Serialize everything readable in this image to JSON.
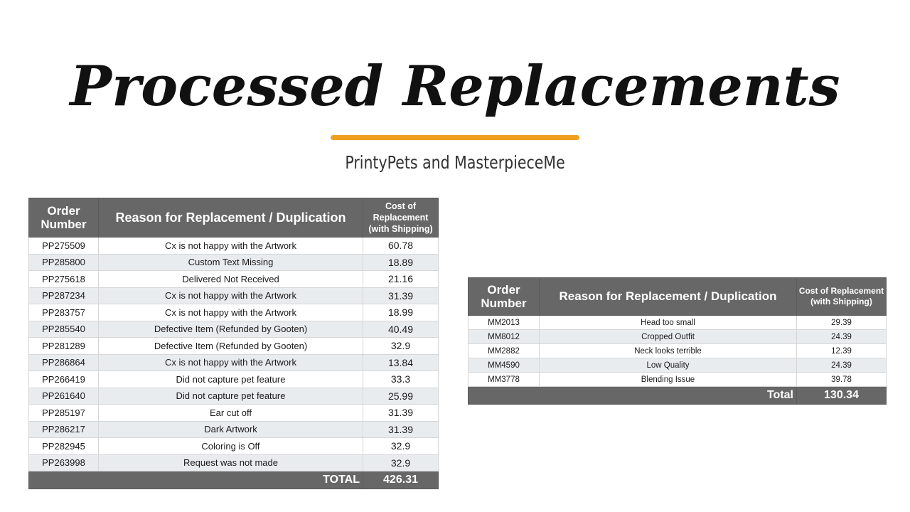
{
  "header": {
    "title": "Processed Replacements",
    "subtitle": "PrintyPets and MasterpieceMe"
  },
  "colors": {
    "accent_underline": "#f0a020",
    "table_header_bg": "#676767",
    "row_stripe_bg": "#e9ecef"
  },
  "printypets": {
    "headers": {
      "order": "Order Number",
      "reason": "Reason for Replacement / Duplication",
      "cost": "Cost of Replacement (with Shipping)"
    },
    "rows": [
      {
        "order": "PP275509",
        "reason": "Cx is not happy with the Artwork",
        "cost": "60.78"
      },
      {
        "order": "PP285800",
        "reason": "Custom Text Missing",
        "cost": "18.89"
      },
      {
        "order": "PP275618",
        "reason": "Delivered Not Received",
        "cost": "21.16"
      },
      {
        "order": "PP287234",
        "reason": "Cx is not happy with the Artwork",
        "cost": "31.39"
      },
      {
        "order": "PP283757",
        "reason": "Cx is not happy with the Artwork",
        "cost": "18.99"
      },
      {
        "order": "PP285540",
        "reason": "Defective Item (Refunded by Gooten)",
        "cost": "40.49"
      },
      {
        "order": "PP281289",
        "reason": "Defective Item (Refunded by Gooten)",
        "cost": "32.9"
      },
      {
        "order": "PP286864",
        "reason": "Cx is not happy with the Artwork",
        "cost": "13.84"
      },
      {
        "order": "PP266419",
        "reason": "Did not capture pet feature",
        "cost": "33.3"
      },
      {
        "order": "PP261640",
        "reason": "Did not capture pet feature",
        "cost": "25.99"
      },
      {
        "order": "PP285197",
        "reason": "Ear cut off",
        "cost": "31.39"
      },
      {
        "order": "PP286217",
        "reason": "Dark Artwork",
        "cost": "31.39"
      },
      {
        "order": "PP282945",
        "reason": "Coloring is Off",
        "cost": "32.9"
      },
      {
        "order": "PP263998",
        "reason": "Request was not made",
        "cost": "32.9"
      }
    ],
    "total_label": "TOTAL",
    "total_value": "426.31"
  },
  "masterpieceme": {
    "headers": {
      "order": "Order Number",
      "reason": "Reason for Replacement / Duplication",
      "cost": "Cost of Replacement (with Shipping)"
    },
    "rows": [
      {
        "order": "MM2013",
        "reason": "Head too small",
        "cost": "29.39"
      },
      {
        "order": "MM8012",
        "reason": "Cropped Outfit",
        "cost": "24.39"
      },
      {
        "order": "MM2882",
        "reason": "Neck looks terrible",
        "cost": "12.39"
      },
      {
        "order": "MM4590",
        "reason": "Low Quality",
        "cost": "24.39"
      },
      {
        "order": "MM3778",
        "reason": "Blending Issue",
        "cost": "39.78"
      }
    ],
    "total_label": "Total",
    "total_value": "130.34"
  }
}
